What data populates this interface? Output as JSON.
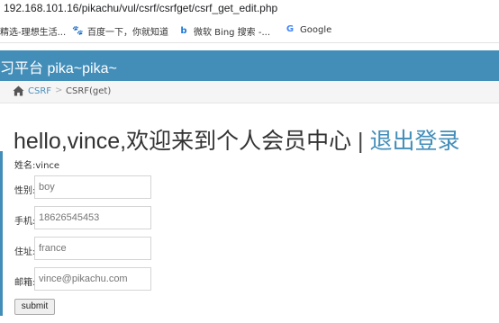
{
  "browser": {
    "url": "192.168.101.16/pikachu/vul/csrf/csrfget/csrf_get_edit.php",
    "bookmarks": [
      {
        "label": "精选-理想生活...",
        "icon": ""
      },
      {
        "label": "百度一下，你就知道",
        "icon": "baidu-paw-icon"
      },
      {
        "label": "微软 Bing 搜索 -...",
        "icon": "bing-icon"
      },
      {
        "label": "Google",
        "icon": "google-icon"
      }
    ]
  },
  "header": {
    "title": "习平台 pika~pika~",
    "color": "#438eb9"
  },
  "breadcrumb": {
    "link": "CSRF",
    "separator": ">",
    "current": "CSRF(get)"
  },
  "main": {
    "greeting": "hello,vince,欢迎来到个人会员中心",
    "separator": "|",
    "logout": "退出登录",
    "name_label": "姓名:vince",
    "fields": [
      {
        "label": "性别:",
        "value": "boy"
      },
      {
        "label": "手机:",
        "value": "18626545453"
      },
      {
        "label": "住址:",
        "value": "france"
      },
      {
        "label": "邮箱:",
        "value": "vince@pikachu.com"
      }
    ],
    "submit": "submit"
  }
}
